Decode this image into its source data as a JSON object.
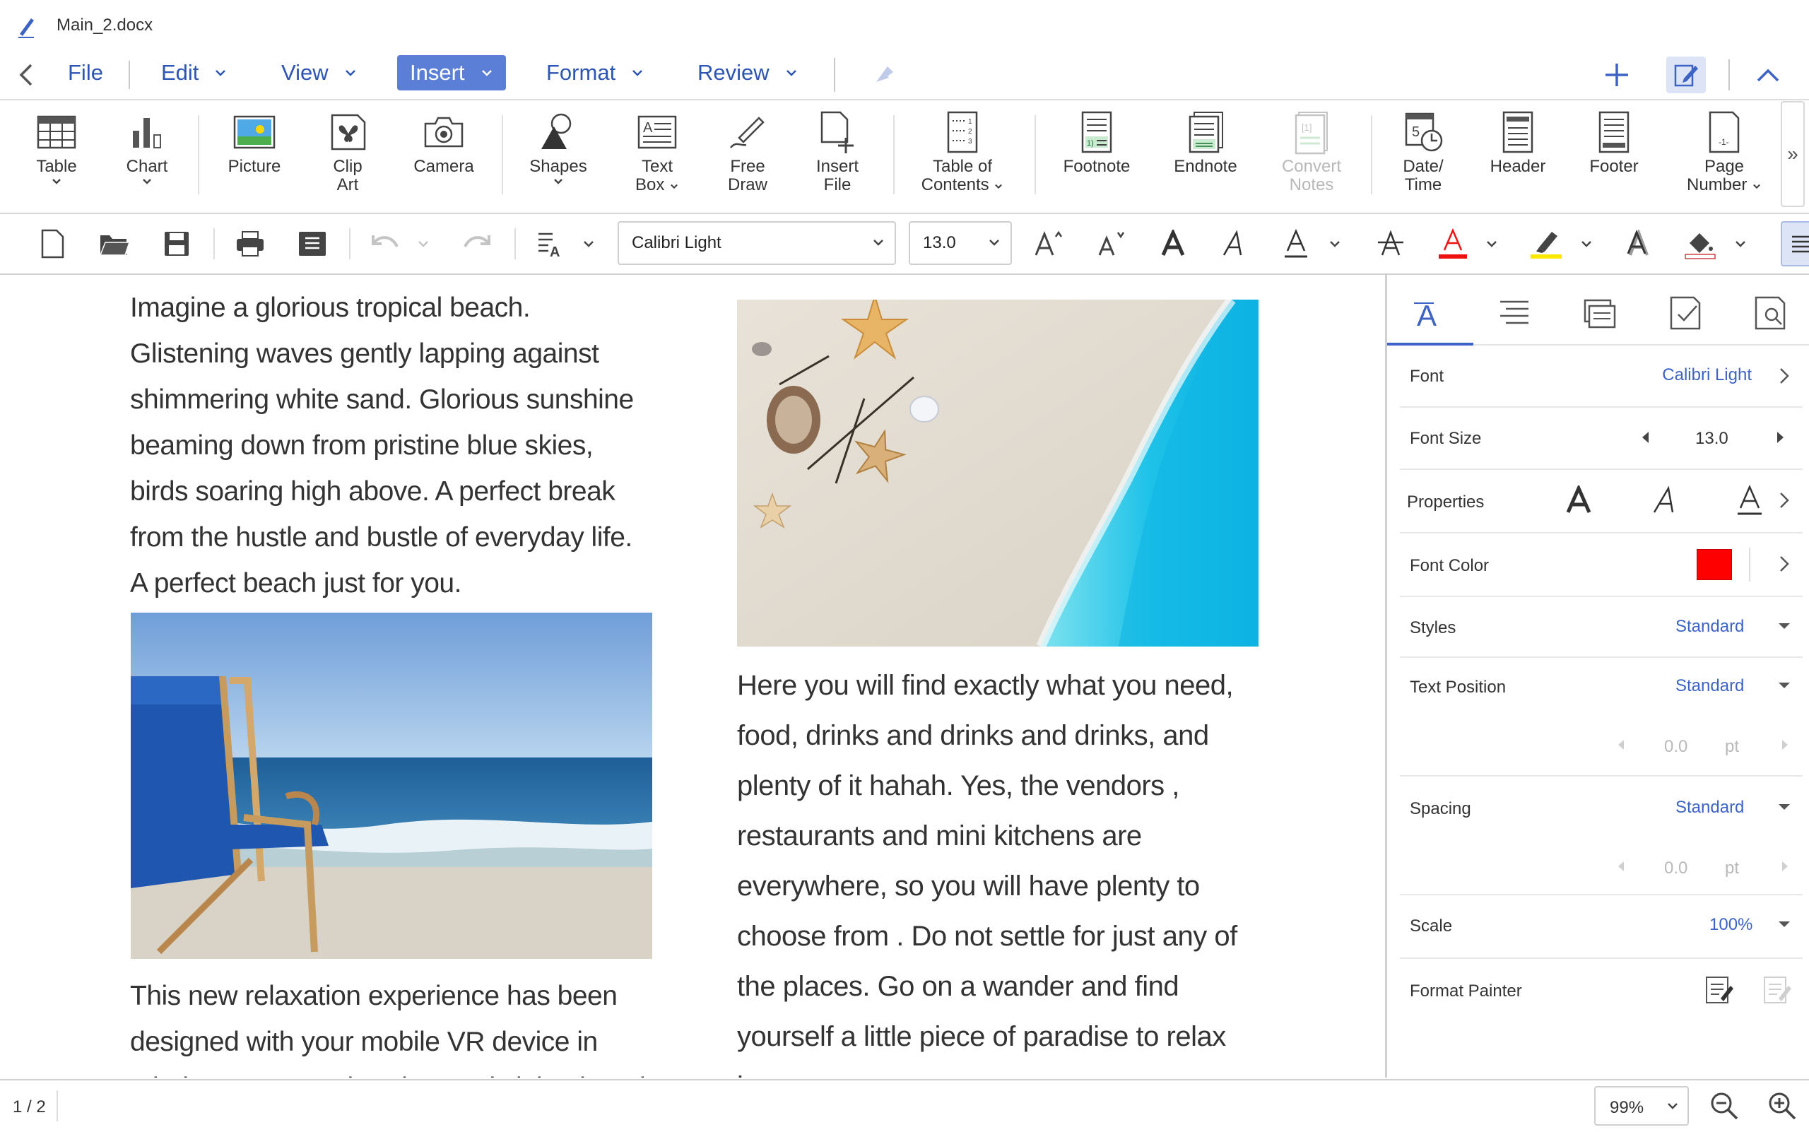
{
  "title_bar": {
    "doc_name": "Main_2.docx",
    "app_icon": "pen-icon"
  },
  "menu": {
    "items": [
      {
        "label": "File"
      },
      {
        "label": "Edit"
      },
      {
        "label": "View"
      },
      {
        "label": "Insert",
        "active": true
      },
      {
        "label": "Format"
      },
      {
        "label": "Review"
      }
    ],
    "right_icons": [
      "plus-icon",
      "edit-mode-icon",
      "collapse-ribbon-icon"
    ]
  },
  "ribbon": {
    "table": "Table",
    "chart": "Chart",
    "picture": "Picture",
    "clip_art_1": "Clip",
    "clip_art_2": "Art",
    "camera": "Camera",
    "shapes": "Shapes",
    "text_box_1": "Text",
    "text_box_2": "Box",
    "free_draw_1": "Free",
    "free_draw_2": "Draw",
    "insert_file_1": "Insert",
    "insert_file_2": "File",
    "toc_1": "Table of",
    "toc_2": "Contents",
    "footnote": "Footnote",
    "endnote": "Endnote",
    "convert_notes_1": "Convert",
    "convert_notes_2": "Notes",
    "date_time_1": "Date/",
    "date_time_2": "Time",
    "header": "Header",
    "footer": "Footer",
    "page_number_1": "Page",
    "page_number_2": "Number",
    "more": "»"
  },
  "format_bar": {
    "font": "Calibri Light",
    "size": "13.0"
  },
  "document": {
    "para1": "Imagine a glorious tropical beach. Glistening waves gently lapping against shimmering white sand. Glorious sunshine beaming down from pristine blue skies, birds soaring high above. A perfect break from the hustle and bustle of everyday life. A perfect beach just for you.",
    "para2": "Here you will find exactly what you need, food, drinks and drinks and drinks, and plenty of it hahah. Yes, the  vendors , restaurants   and   mini kitchens   are everywhere, so you will have   plenty to choose from . Do not settle for just any of the places. Go on a wander and find yourself a little piece of paradise to relax in.",
    "para3": " This new relaxation experience has been designed with your mobile VR device in mind. Put on your headset and sit back and relax."
  },
  "panel": {
    "font_label": "Font",
    "font_value": "Calibri Light",
    "size_label": "Font Size",
    "size_value": "13.0",
    "properties_label": "Properties",
    "color_label": "Font Color",
    "color_value": "#ff0000",
    "styles_label": "Styles",
    "styles_value": "Standard",
    "textpos_label": "Text Position",
    "textpos_value": "Standard",
    "textpos_num": "0.0",
    "textpos_unit": "pt",
    "spacing_label": "Spacing",
    "spacing_value": "Standard",
    "spacing_num": "0.0",
    "spacing_unit": "pt",
    "scale_label": "Scale",
    "scale_value": "100%",
    "painter_label": "Format Painter"
  },
  "status": {
    "page": "1 / 2",
    "zoom": "99%"
  },
  "colors": {
    "accent": "#3d63c4",
    "active_menu": "#5b7fd6",
    "font_color": "#ff0000",
    "highlight": "#ffe800"
  }
}
